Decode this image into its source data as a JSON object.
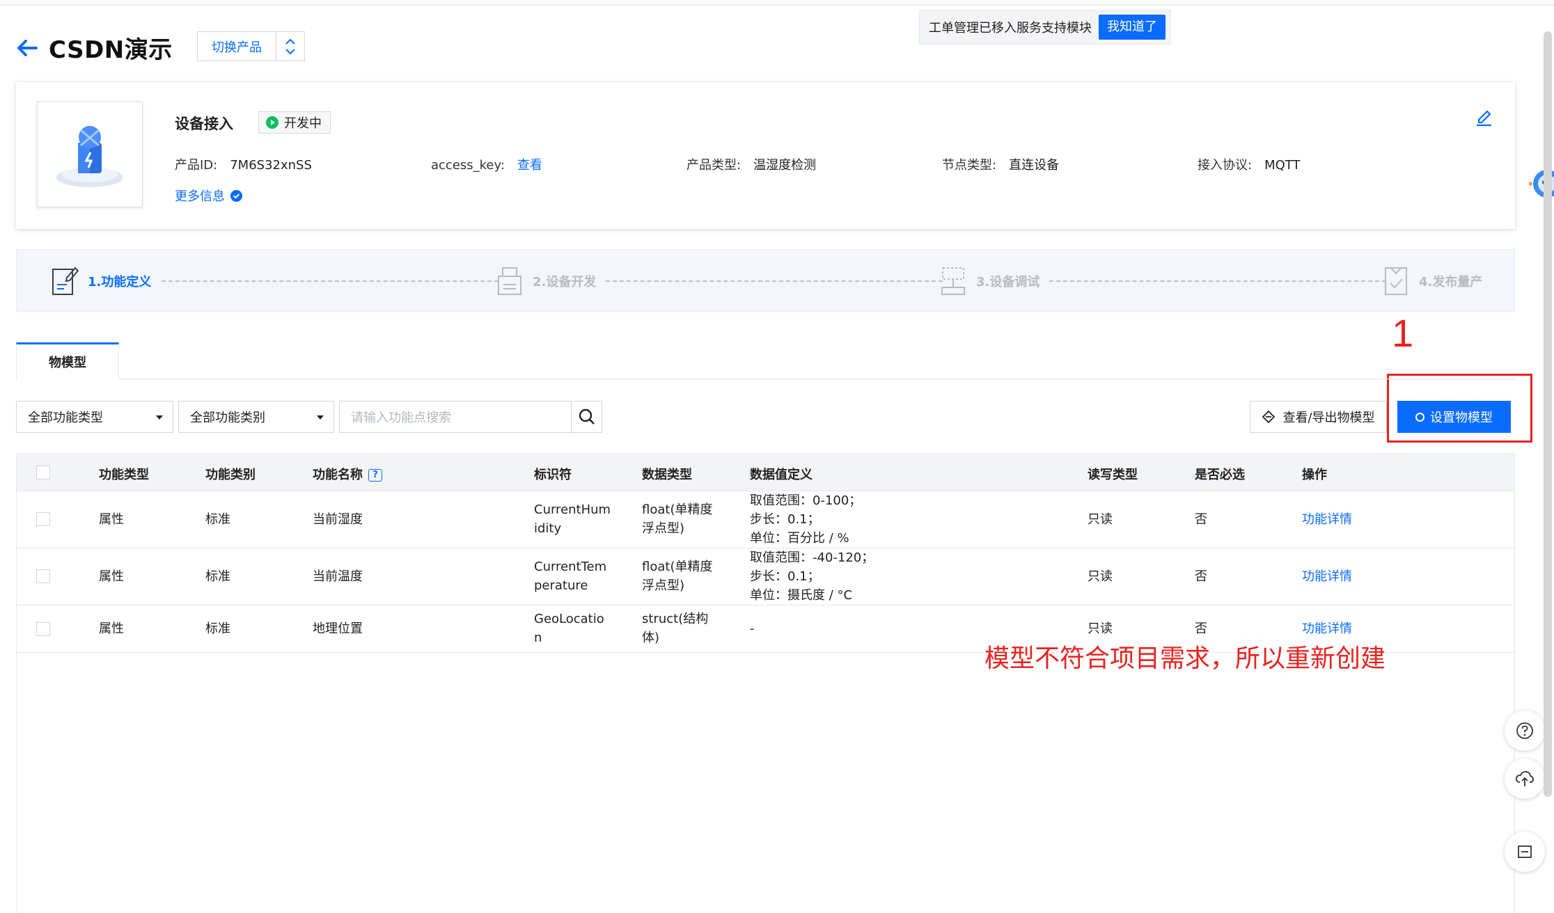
{
  "toast": {
    "message": "工单管理已移入服务支持模块",
    "button": "我知道了"
  },
  "header": {
    "title": "CSDN演示",
    "switch_product": "切换产品"
  },
  "product": {
    "section_title": "设备接入",
    "status": "开发中",
    "product_id_label": "产品ID:",
    "product_id": "7M6S32xnSS",
    "access_key_label": "access_key:",
    "access_key_link": "查看",
    "product_type_label": "产品类型:",
    "product_type": "温湿度检测",
    "node_type_label": "节点类型:",
    "node_type": "直连设备",
    "protocol_label": "接入协议:",
    "protocol": "MQTT",
    "more_info": "更多信息"
  },
  "steps": [
    {
      "label": "1.功能定义",
      "state": "active"
    },
    {
      "label": "2.设备开发",
      "state": "inactive"
    },
    {
      "label": "3.设备调试",
      "state": "inactive"
    },
    {
      "label": "4.发布量产",
      "state": "inactive"
    }
  ],
  "tabs": [
    {
      "label": "物模型",
      "active": true
    }
  ],
  "filters": {
    "function_type": "全部功能类型",
    "function_category": "全部功能类别",
    "search_placeholder": "请输入功能点搜索"
  },
  "actions": {
    "export": "查看/导出物模型",
    "setup": "设置物模型"
  },
  "table": {
    "headers": {
      "type": "功能类型",
      "category": "功能类别",
      "name": "功能名称",
      "identifier": "标识符",
      "data_type": "数据类型",
      "data_def": "数据值定义",
      "rw": "读写类型",
      "required": "是否必选",
      "op": "操作"
    },
    "rows": [
      {
        "type": "属性",
        "category": "标准",
        "name": "当前湿度",
        "identifier_l1": "CurrentHum",
        "identifier_l2": "idity",
        "data_type_l1": "float(单精度",
        "data_type_l2": "浮点型)",
        "def_l1": "取值范围：0-100；",
        "def_l2": "步长：0.1；",
        "def_l3": "单位：百分比 / %",
        "rw": "只读",
        "required": "否",
        "op": "功能详情"
      },
      {
        "type": "属性",
        "category": "标准",
        "name": "当前温度",
        "identifier_l1": "CurrentTem",
        "identifier_l2": "perature",
        "data_type_l1": "float(单精度",
        "data_type_l2": "浮点型)",
        "def_l1": "取值范围：-40-120；",
        "def_l2": "步长：0.1；",
        "def_l3": "单位：摄氏度 / °C",
        "rw": "只读",
        "required": "否",
        "op": "功能详情"
      },
      {
        "type": "属性",
        "category": "标准",
        "name": "地理位置",
        "identifier_l1": "GeoLocatio",
        "identifier_l2": "n",
        "data_type_l1": "struct(结构",
        "data_type_l2": "体)",
        "def_l1": "-",
        "rw": "只读",
        "required": "否",
        "op": "功能详情"
      }
    ]
  },
  "annotations": {
    "number": "1",
    "note": "模型不符合项目需求，所以重新创建"
  },
  "colors": {
    "primary": "#0a6cff",
    "annotation": "#e8231f",
    "status_green": "#0abf5b"
  },
  "icons": [
    "back-arrow-icon",
    "chevron-updown-icon",
    "edit-icon",
    "check-circle-icon",
    "search-icon",
    "help-icon",
    "cloud-upload-icon",
    "collapse-icon"
  ]
}
